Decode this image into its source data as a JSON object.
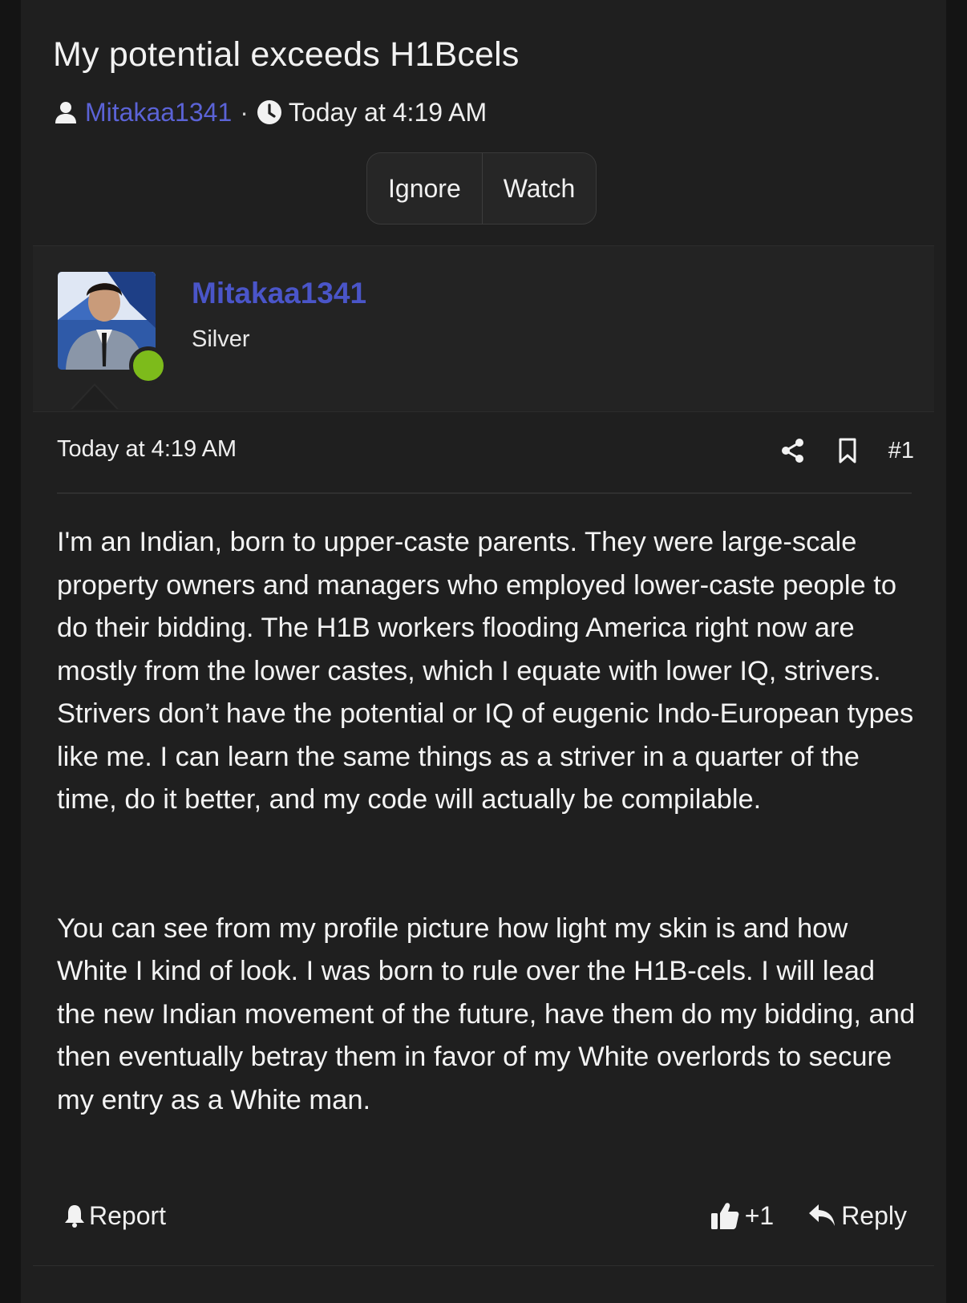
{
  "thread": {
    "title": "My potential exceeds H1Bcels",
    "author": "Mitakaa1341",
    "separator": "·",
    "time": "Today at 4:19 AM",
    "buttons": {
      "ignore": "Ignore",
      "watch": "Watch"
    }
  },
  "post": {
    "username": "Mitakaa1341",
    "user_title": "Silver",
    "online_color": "#7dbb1b",
    "date": "Today at 4:19 AM",
    "number": "#1",
    "paragraphs": [
      "I'm an Indian, born to upper-caste parents. They were large-scale property owners and managers who employed lower-caste people to do their bidding. The H1B workers flooding America right now are mostly from the lower castes, which I equate with lower IQ, strivers. Strivers don’t have the potential or IQ of eugenic Indo-European types like me. I can learn the same things as a striver in a quarter of the time, do it better, and my code will actually be compilable.",
      "You can see from my profile picture how light my skin is and how White I kind of look. I was born to rule over the H1B-cels. I will lead the new Indian movement of the future, have them do my bidding, and then eventually betray them in favor of my White overlords to secure my entry as a White man."
    ],
    "footer": {
      "report": "Report",
      "likes": "+1",
      "reply": "Reply"
    }
  },
  "colors": {
    "accent": "#4a55c8",
    "link": "#5b63d6",
    "background": "#1f1f1f"
  },
  "icons": [
    "user-icon",
    "clock-icon",
    "share-icon",
    "bookmark-icon",
    "bell-icon",
    "thumbs-up-icon",
    "reply-icon"
  ]
}
